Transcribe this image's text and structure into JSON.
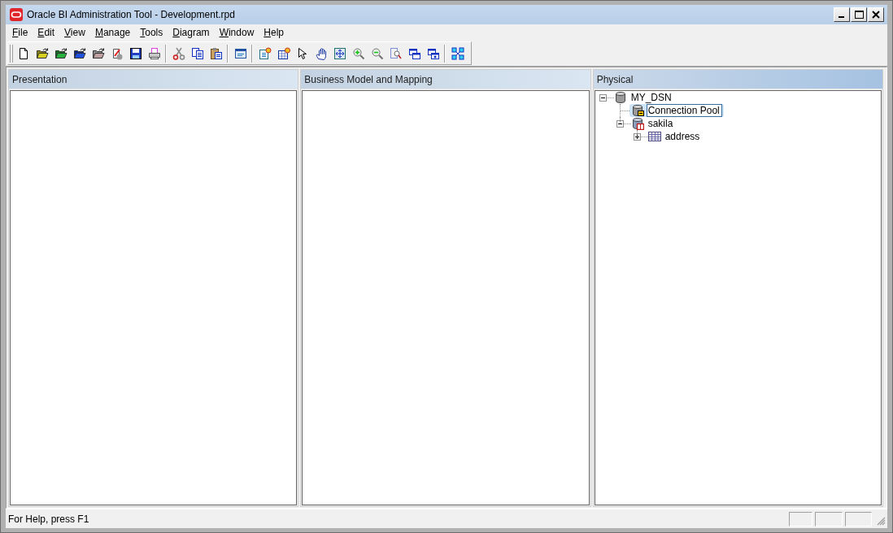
{
  "window": {
    "title": "Oracle BI Administration Tool - Development.rpd"
  },
  "menu_bar": [
    "File",
    "Edit",
    "View",
    "Manage",
    "Tools",
    "Diagram",
    "Window",
    "Help"
  ],
  "panes": [
    {
      "title": "Presentation",
      "active": false
    },
    {
      "title": "Business Model and Mapping",
      "active": false
    },
    {
      "title": "Physical",
      "active": true,
      "tree": [
        {
          "label": "MY_DSN",
          "kind": "database",
          "expanded": true,
          "selected": false,
          "children": [
            {
              "label": "Connection Pool",
              "kind": "connection_pool",
              "selected": true
            },
            {
              "label": "sakila",
              "kind": "schema",
              "expanded": true,
              "selected": false,
              "children": [
                {
                  "label": "address",
                  "kind": "table",
                  "expanded": false,
                  "selected": false
                }
              ]
            }
          ]
        }
      ]
    }
  ],
  "status_bar": {
    "text": "For Help, press F1"
  }
}
